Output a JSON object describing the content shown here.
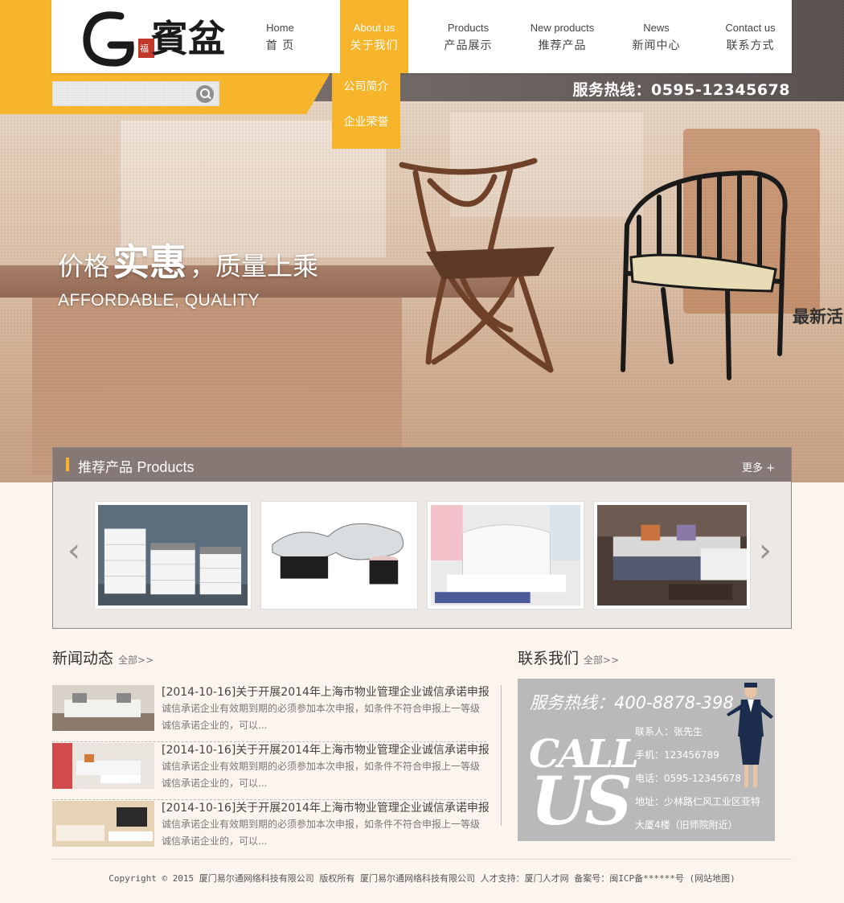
{
  "logo": {
    "text": "賓盆"
  },
  "nav": [
    {
      "en": "Home",
      "cn": "首 页"
    },
    {
      "en": "About us",
      "cn": "关于我们"
    },
    {
      "en": "Products",
      "cn": "产品展示"
    },
    {
      "en": "New products",
      "cn": "推荐产品"
    },
    {
      "en": "News",
      "cn": "新闻中心"
    },
    {
      "en": "Contact us",
      "cn": "联系方式"
    }
  ],
  "dropdown": [
    "公司简介",
    "企业荣誉"
  ],
  "search": {
    "placeholder": ""
  },
  "hotline_top": "服务热线：0595-12345678",
  "banner": {
    "line1_a": "价格",
    "line1_b": "实惠",
    "line1_c": "，质量上乘",
    "line2": "AFFORDABLE, QUALITY",
    "side": "最新活"
  },
  "products": {
    "title_cn": "推荐产品",
    "title_en": "Products",
    "more": "更多 +"
  },
  "news": {
    "title": "新闻动态",
    "all": "全部>>",
    "items": [
      {
        "title": "[2014-10-16]关于开展2014年上海市物业管理企业诚信承诺申报",
        "desc": "诚信承诺企业有效期到期的必须参加本次申报，如条件不符合申报上一等级诚信承诺企业的，可以..."
      },
      {
        "title": "[2014-10-16]关于开展2014年上海市物业管理企业诚信承诺申报",
        "desc": "诚信承诺企业有效期到期的必须参加本次申报，如条件不符合申报上一等级诚信承诺企业的，可以..."
      },
      {
        "title": "[2014-10-16]关于开展2014年上海市物业管理企业诚信承诺申报",
        "desc": "诚信承诺企业有效期到期的必须参加本次申报，如条件不符合申报上一等级诚信承诺企业的，可以..."
      }
    ]
  },
  "contact": {
    "title": "联系我们",
    "all": "全部>>",
    "hotline": "服务热线：400-8878-398",
    "call": "CALL",
    "us": "US",
    "person": "联系人：张先生",
    "phone": "手机：123456789",
    "tel": "电话：0595-12345678",
    "address1": "地址：少林路仁风工业区亚特",
    "address2": "大厦4楼（旧师院附近）"
  },
  "footer": "Copyright © 2015 厦门易尔通网络科技有限公司 版权所有 厦门易尔通网络科技有限公司 人才支持：厦门人才网 备案号：闽ICP备******号 (网站地图)",
  "colors": {
    "accent": "#f7b52c",
    "bar": "#736460",
    "contact_bg": "#b9b9b9"
  }
}
